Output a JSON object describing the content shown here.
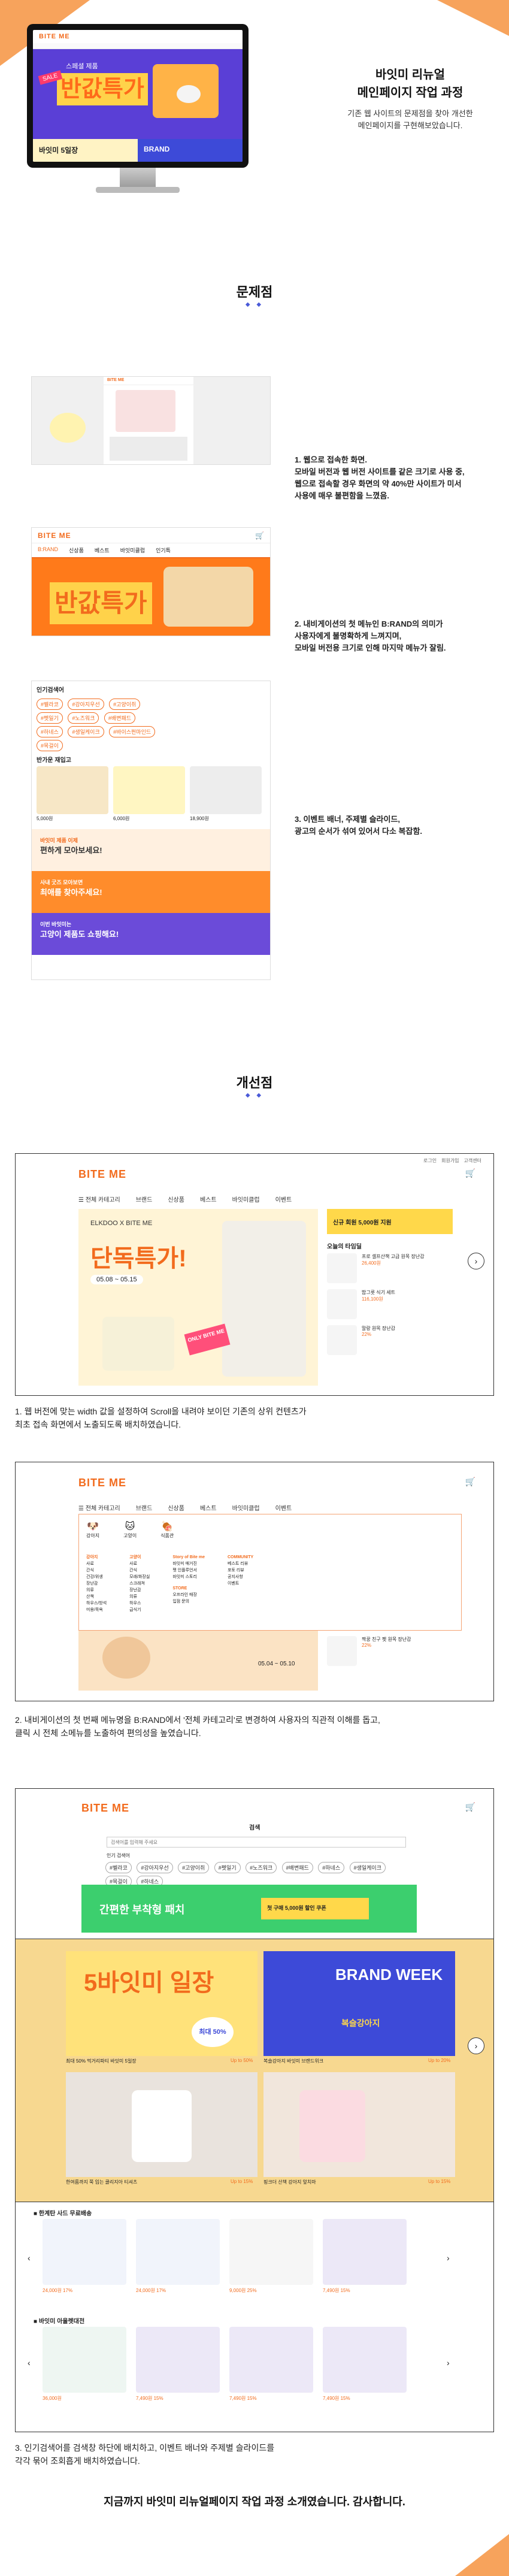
{
  "header": {
    "title_line1": "바잇미 리뉴얼",
    "title_line2": "메인페이지 작업 과정",
    "subtitle_line1": "기존 웹 사이트의 문제점을 찾아 개선한",
    "subtitle_line2": "메인페이지를 구현해보았습니다."
  },
  "monitor": {
    "logo": "BITE ME",
    "hero_small": "스페셜 제품",
    "hero_big": "반값특가",
    "sale_badge": "SALE",
    "bottom_banner": "바잇미 5일장",
    "brand_banner": "BRAND"
  },
  "problems": {
    "section_title": "문제점",
    "diamonds": "◆ ◆",
    "items": [
      {
        "line1": "1. 웹으로 접속한 화면.",
        "line2": "모바일 버전과 웹 버전 사이트를 같은 크기로 사용 중,",
        "line3": "웹으로 접속할 경우 화면의 약 40%만 사이트가 미서",
        "line4": "사용에 매우 불편함을 느꼈음."
      },
      {
        "line1": "2. 내비게이션의 첫 메뉴인 B:RAND의 의미가",
        "line2": "사용자에게 불명확하게 느껴지며,",
        "line3": "모바일 버전용 크기로 인해 마지막 메뉴가 잘림."
      },
      {
        "line1": "3. 이벤트 배너, 주제별 슬라이드,",
        "line2": "광고의 순서가 섞여 있어서 다소 복잡함."
      }
    ],
    "shot2": {
      "logo": "BITE ME",
      "tabs": [
        "B:RAND",
        "신상품",
        "베스트",
        "바잇미클럽",
        "인기특"
      ],
      "hero_big": "반값특가"
    },
    "shot3": {
      "popular_title": "인기검색어",
      "pills": [
        "#벨라코",
        "#강아지우선",
        "#고양이쥐",
        "#펫일기",
        "#노즈워크",
        "#배변패드",
        "#하네스",
        "#생일케이크",
        "#바이스펀마인드",
        "#목걸이"
      ],
      "event_title": "반가운 재입고",
      "price1": "5,000원",
      "price2": "6,000원",
      "price3": "18,900원",
      "banner1_line1": "바잇미 제품 이제",
      "banner1_line2": "편하게 모아보세요!",
      "banner2_line1": "사내 굿즈 모아보면",
      "banner2_line2": "최애를 찾아주세요!",
      "banner3_line1": "이번 바잇미는",
      "banner3_line2": "고양이 제품도 쇼핑해요!"
    }
  },
  "improvements": {
    "section_title": "개선점",
    "diamonds": "◆ ◆",
    "shot1": {
      "logo": "BITE ME",
      "top_links": [
        "로그인",
        "회원가입",
        "고객센터"
      ],
      "nav": [
        "☰ 전체 카테고리",
        "브랜드",
        "신상품",
        "베스트",
        "바잇미클럽",
        "이벤트"
      ],
      "hero_tag": "ELKDOO X BITE ME",
      "hero_big": "단독특가!",
      "hero_date": "05.08 ~ 05.15",
      "badge": "ONLY BITE ME",
      "side_banner": "신규 회원 5,000원 지원",
      "side_title": "오늘의 타임딜",
      "side_item1": "프로 셀프산책 고급 원목 장난감",
      "side_price1": "26,400원",
      "side_item2": "밥그릇 식기 세트",
      "side_price2": "116,100원",
      "side_item3": "말랑 원목 장난감",
      "side_price3": "22%"
    },
    "caption1_line1": "1. 웹 버전에 맞는 width 값을 설정하여 Scroll을 내려야 보이던 기존의 상위 컨텐츠가",
    "caption1_line2": "최초 접속 화면에서 노출되도록 배치하였습니다.",
    "shot2": {
      "logo": "BITE ME",
      "nav": [
        "☰ 전체 카테고리",
        "브랜드",
        "신상품",
        "베스트",
        "바잇미클럽",
        "이벤트"
      ],
      "icons": [
        "강아지",
        "고양이",
        "식품관"
      ],
      "col1_title": "강아지",
      "col1": [
        "사료",
        "간식",
        "건강/위생",
        "장난감",
        "의류",
        "산책",
        "하우스/방석",
        "미용/목욕"
      ],
      "col2_title": "고양이",
      "col2": [
        "사료",
        "간식",
        "모래/화장실",
        "스크래쳐",
        "장난감",
        "의류",
        "하우스",
        "급식기"
      ],
      "col3_title": "Story of Bite me",
      "col3": [
        "바잇미 매거진",
        "펫 인플루언서",
        "바잇미 스토리"
      ],
      "col4_title": "COMMUNITY",
      "col4": [
        "베스트 리뷰",
        "포토 리뷰",
        "공지사항",
        "이벤트"
      ],
      "col5_title": "STORE",
      "col5": [
        "오프라인 매장",
        "입점 문의"
      ],
      "hero_date": "05.04 ~ 05.10",
      "side_item": "짝꿍 친구 펫 원목 장난감",
      "side_price": "22%"
    },
    "caption2_line1": "2. 내비게이션의 첫 번째 메뉴명을 B:RAND에서 '전체 카테고리'로 변경하여 사용자의 직관적 이해를 돕고,",
    "caption2_line2": "클릭 시 전체 소메뉴를 노출하여 편의성을 높였습니다.",
    "shot3": {
      "logo": "BITE ME",
      "search_label": "검색",
      "search_placeholder": "검색어를 입력해 주세요",
      "popular_title": "인기 검색어",
      "pills": [
        "#벨라코",
        "#강아지우선",
        "#고양이쥐",
        "#펫일기",
        "#노즈워크",
        "#배변패드",
        "#하네스",
        "#생일케이크",
        "#목걸이",
        "#하네스"
      ],
      "green_banner": "간편한 부착형 패치",
      "coupon": "첫 구매 5,000원 할인 쿠폰",
      "event1_big": "5바잇미 일장",
      "event1_tag": "최대 50%",
      "event1_caption": "최대 50% 먹거리파티 바잇미 5일장",
      "event1_off": "Up to 50%",
      "event2_big": "BRAND WEEK",
      "event2_sub": "복슬강아지",
      "event2_caption": "복슬강아지 바잇미 브랜드위크",
      "event2_off": "Up to 20%",
      "event3_caption": "한여름까지 쭉 입는 쿨리지아 티셔츠",
      "event3_off": "Up to 15%",
      "event4_caption": "핑크더 산책 강아지 앞치마",
      "event4_off": "Up to 15%",
      "slider1_title": "■ 한계탄 사드 무료배송",
      "slider1_prices": [
        "24,000원 17%",
        "24,000원 17%",
        "9,000원 25%",
        "7,490원 15%"
      ],
      "slider2_title": "■ 바잇미 아울렛대전",
      "slider2_prices": [
        "36,000원",
        "7,490원 15%",
        "7,490원 15%",
        "7,490원 15%"
      ]
    },
    "caption3_line1": "3. 인기검색어를 검색창 하단에 배치하고, 이벤트 배너와 주제별 슬라이드를",
    "caption3_line2": "각각 묶어 조회흡게 배치하였습니다."
  },
  "closing": "지금까지 바잇미 리뉴얼페이지 작업 과정 소개였습니다. 감사합니다.",
  "colors": {
    "accent": "#f26b1d",
    "purple": "#5a3fd6",
    "diamond": "#4a5ad8"
  }
}
